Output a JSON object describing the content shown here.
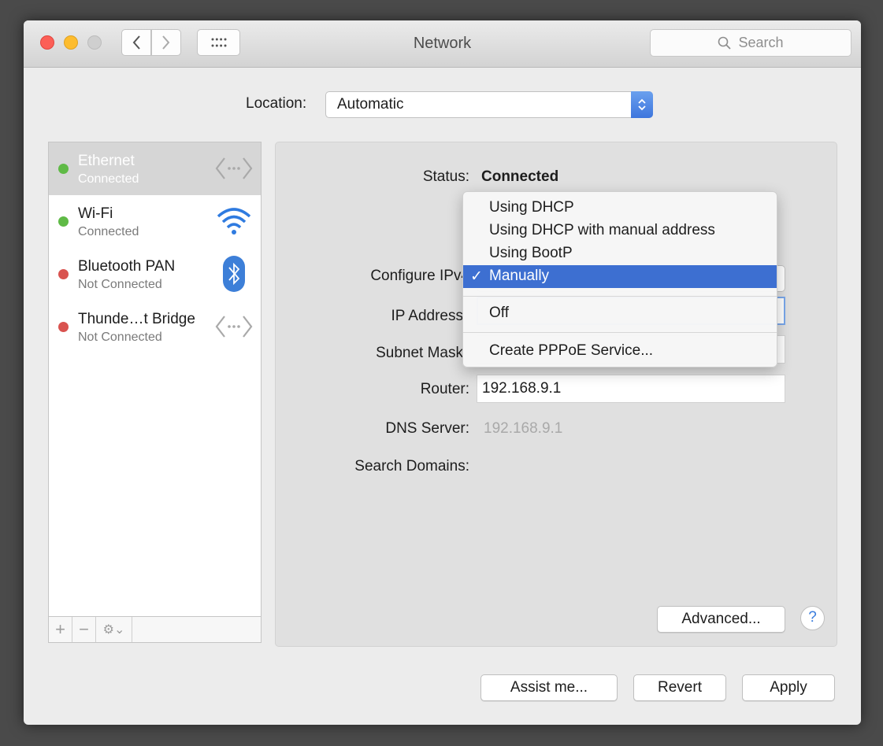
{
  "window": {
    "title": "Network",
    "search_placeholder": "Search"
  },
  "location": {
    "label": "Location:",
    "value": "Automatic"
  },
  "services": [
    {
      "name": "Ethernet",
      "status": "Connected",
      "status_color": "#5fba46",
      "icon": "ethernet-icon",
      "selected": true
    },
    {
      "name": "Wi-Fi",
      "status": "Connected",
      "status_color": "#5fba46",
      "icon": "wifi-icon",
      "selected": false
    },
    {
      "name": "Bluetooth PAN",
      "status": "Not Connected",
      "status_color": "#d9534f",
      "icon": "bluetooth-icon",
      "selected": false
    },
    {
      "name": "Thunde…t Bridge",
      "status": "Not Connected",
      "status_color": "#d9534f",
      "icon": "ethernet-icon",
      "selected": false
    }
  ],
  "sidebar_toolbar": {
    "add": "+",
    "remove": "−",
    "gear": "⚙︎⌄"
  },
  "detail": {
    "status_label": "Status:",
    "status_value": "Connected",
    "configure_label": "Configure IPv4",
    "ip_label": "IP Address",
    "subnet_label": "Subnet Mask",
    "router_label": "Router:",
    "router_value": "192.168.9.1",
    "dns_label": "DNS Server:",
    "dns_value": "192.168.9.1",
    "search_domains_label": "Search Domains:"
  },
  "configure_menu": {
    "items": [
      "Using DHCP",
      "Using DHCP with manual address",
      "Using BootP",
      "Manually",
      "Off",
      "Create PPPoE Service..."
    ],
    "selected": "Manually",
    "check": "✓"
  },
  "buttons": {
    "advanced": "Advanced...",
    "help": "?",
    "assist": "Assist me...",
    "revert": "Revert",
    "apply": "Apply"
  }
}
